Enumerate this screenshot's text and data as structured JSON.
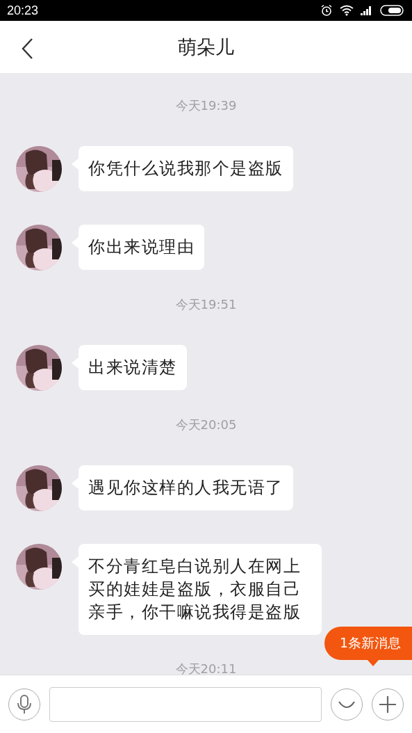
{
  "status_bar": {
    "time": "20:23"
  },
  "header": {
    "title": "萌朵儿"
  },
  "messages": [
    {
      "kind": "timestamp",
      "text": "今天19:39"
    },
    {
      "kind": "message",
      "text": "你凭什么说我那个是盗版"
    },
    {
      "kind": "message",
      "text": "你出来说理由"
    },
    {
      "kind": "timestamp",
      "text": "今天19:51"
    },
    {
      "kind": "message",
      "text": "出来说清楚"
    },
    {
      "kind": "timestamp",
      "text": "今天20:05"
    },
    {
      "kind": "message",
      "text": "遇见你这样的人我无语了"
    },
    {
      "kind": "message",
      "text": "不分青红皂白说别人在网上买的娃娃是盗版，衣服自己亲手，你干嘛说我得是盗版"
    },
    {
      "kind": "timestamp",
      "text": "今天20:11"
    }
  ],
  "new_message_badge": "1条新消息"
}
